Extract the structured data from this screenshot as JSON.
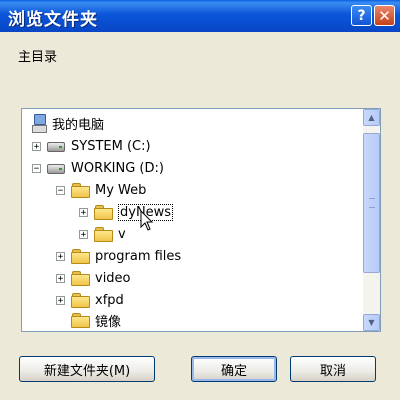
{
  "window": {
    "title": "浏览文件夹",
    "help_glyph": "?",
    "close_glyph": "✕"
  },
  "section_label": "主目录",
  "tree": {
    "items": [
      {
        "label": "我的电脑",
        "icon": "computer-icon",
        "expander": ""
      },
      {
        "label": "SYSTEM (C:)",
        "icon": "drive-icon",
        "expander": "+"
      },
      {
        "label": "WORKING (D:)",
        "icon": "drive-icon",
        "expander": "−"
      },
      {
        "label": "My Web",
        "icon": "folder-open-icon",
        "expander": "−"
      },
      {
        "label": "dyNews",
        "icon": "folder-icon",
        "expander": "+",
        "selected": true
      },
      {
        "label": "v",
        "icon": "folder-icon",
        "expander": "+"
      },
      {
        "label": "program files",
        "icon": "folder-icon",
        "expander": "+"
      },
      {
        "label": "video",
        "icon": "folder-icon",
        "expander": "+"
      },
      {
        "label": "xfpd",
        "icon": "folder-icon",
        "expander": "+"
      },
      {
        "label": "镜像",
        "icon": "folder-icon",
        "expander": ""
      }
    ]
  },
  "scrollbar": {
    "up_glyph": "▲",
    "down_glyph": "▼"
  },
  "buttons": {
    "new_folder": "新建文件夹(M)",
    "ok": "确定",
    "cancel": "取消"
  }
}
